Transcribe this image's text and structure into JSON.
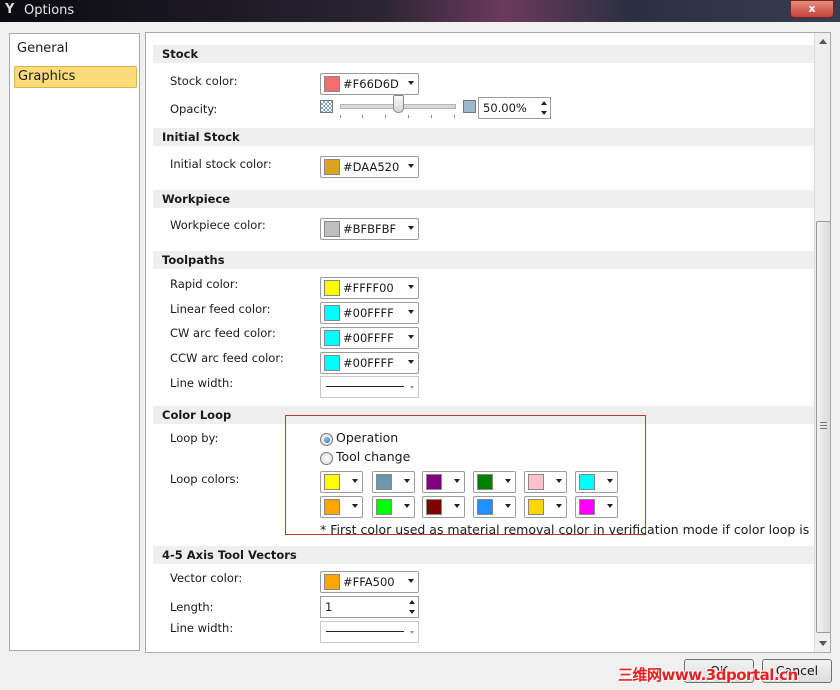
{
  "window": {
    "title": "Options",
    "close_glyph": "x"
  },
  "nav": {
    "items": [
      {
        "label": "General"
      },
      {
        "label": "Graphics"
      }
    ],
    "selected": "Graphics"
  },
  "sections": {
    "stock": {
      "title": "Stock",
      "color_label": "Stock color:",
      "color_value": "#F66D6D",
      "color_hex": "#F66D6D",
      "opacity_label": "Opacity:",
      "opacity_value": "50.00%"
    },
    "initial_stock": {
      "title": "Initial Stock",
      "color_label": "Initial stock color:",
      "color_value": "#DAA520",
      "color_hex": "#DAA520"
    },
    "workpiece": {
      "title": "Workpiece",
      "color_label": "Workpiece color:",
      "color_value": "#BFBFBF",
      "color_hex": "#BFBFBF"
    },
    "toolpaths": {
      "title": "Toolpaths",
      "rapid_label": "Rapid color:",
      "rapid_value": "#FFFF00",
      "linear_label": "Linear feed color:",
      "linear_value": "#00FFFF",
      "cw_label": "CW arc feed color:",
      "cw_value": "#00FFFF",
      "ccw_label": "CCW arc feed color:",
      "ccw_value": "#00FFFF",
      "line_width_label": "Line width:"
    },
    "color_loop": {
      "title": "Color Loop",
      "loop_by_label": "Loop by:",
      "options": [
        "Operation",
        "Tool change"
      ],
      "selected": "Operation",
      "loop_colors_label": "Loop colors:",
      "colors_row1": [
        "#FFFF00",
        "#6C96AE",
        "#800080",
        "#008000",
        "#FFC0CB",
        "#00FFFF"
      ],
      "colors_row2": [
        "#FFA500",
        "#00FF00",
        "#800000",
        "#1E90FF",
        "#FFD700",
        "#FF00FF"
      ],
      "note": "* First color used as material removal color in verification mode if color loop is disable"
    },
    "axis_vectors": {
      "title": "4-5 Axis Tool Vectors",
      "color_label": "Vector color:",
      "color_value": "#FFA500",
      "length_label": "Length:",
      "length_value": "1",
      "line_width_label": "Line width:"
    }
  },
  "buttons": {
    "ok": "OK",
    "cancel": "Cancel"
  },
  "watermark": "三维网www.3dportal.cn"
}
